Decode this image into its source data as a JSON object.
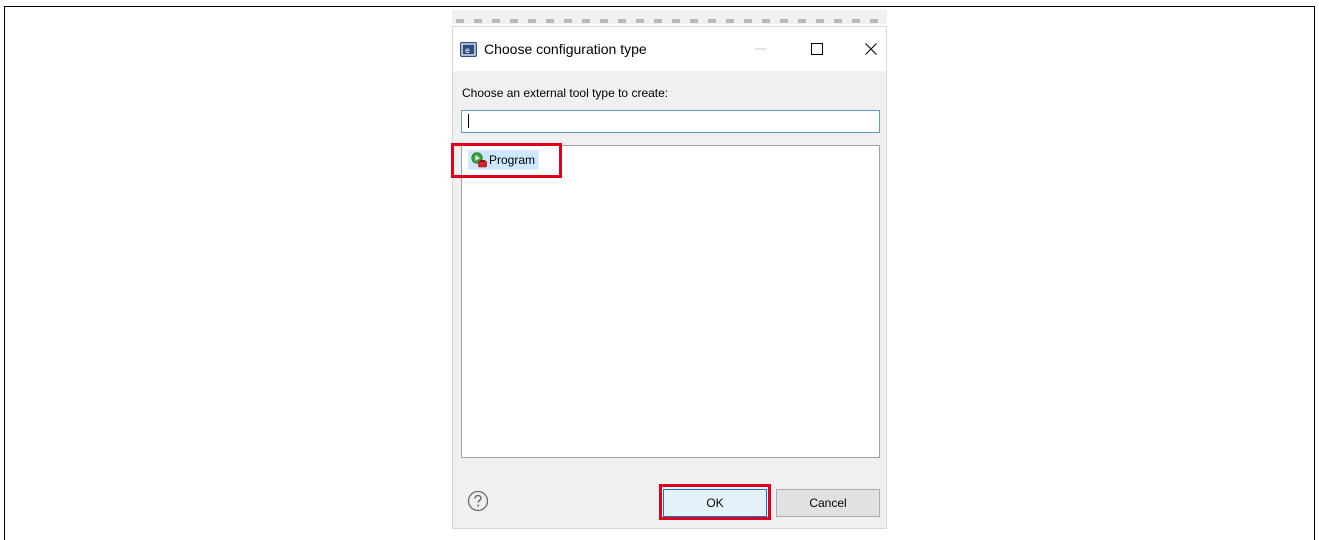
{
  "dialog": {
    "title": "Choose configuration type",
    "prompt": "Choose an external tool type to create:",
    "filter_input": {
      "value": "",
      "placeholder": ""
    },
    "tool_types": [
      {
        "label": "Program",
        "icon": "program-launch-icon",
        "selected": true
      }
    ],
    "buttons": {
      "ok": "OK",
      "cancel": "Cancel"
    },
    "help_icon": "help-question-icon"
  },
  "titlebar_controls": [
    "minimize-icon",
    "maximize-icon",
    "close-icon"
  ],
  "colors": {
    "highlight": "#e0001a",
    "selection": "#cce8ff",
    "focus_border": "#5b9bd5",
    "default_button_border": "#0078d7"
  }
}
